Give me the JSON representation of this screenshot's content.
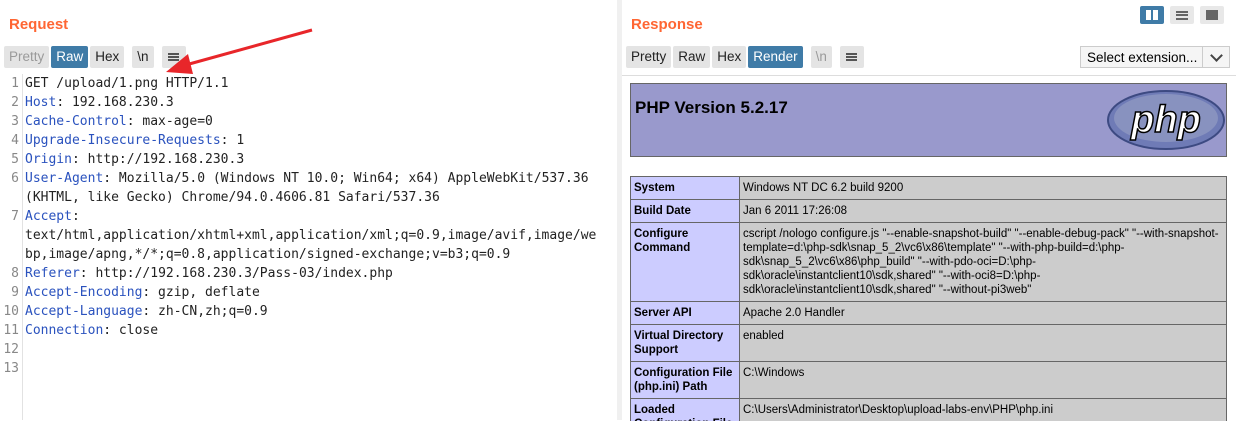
{
  "request": {
    "title": "Request",
    "toolbar": {
      "pretty": "Pretty",
      "raw": "Raw",
      "hex": "Hex",
      "newline": "\\n"
    },
    "lines": [
      {
        "num": "1",
        "key": "",
        "text": "GET /upload/1.png HTTP/1.1"
      },
      {
        "num": "2",
        "key": "Host",
        "text": ": 192.168.230.3"
      },
      {
        "num": "3",
        "key": "Cache-Control",
        "text": ": max-age=0"
      },
      {
        "num": "4",
        "key": "Upgrade-Insecure-Requests",
        "text": ": 1"
      },
      {
        "num": "5",
        "key": "Origin",
        "text": ": http://192.168.230.3"
      },
      {
        "num": "6",
        "key": "User-Agent",
        "text": ": Mozilla/5.0 (Windows NT 10.0; Win64; x64) AppleWebKit/537.36"
      },
      {
        "num": "",
        "key": "",
        "text": "(KHTML, like Gecko) Chrome/94.0.4606.81 Safari/537.36"
      },
      {
        "num": "7",
        "key": "Accept",
        "text": ":"
      },
      {
        "num": "",
        "key": "",
        "text": "text/html,application/xhtml+xml,application/xml;q=0.9,image/avif,image/we"
      },
      {
        "num": "",
        "key": "",
        "text": "bp,image/apng,*/*;q=0.8,application/signed-exchange;v=b3;q=0.9"
      },
      {
        "num": "8",
        "key": "Referer",
        "text": ": http://192.168.230.3/Pass-03/index.php"
      },
      {
        "num": "9",
        "key": "Accept-Encoding",
        "text": ": gzip, deflate"
      },
      {
        "num": "10",
        "key": "Accept-Language",
        "text": ": zh-CN,zh;q=0.9"
      },
      {
        "num": "11",
        "key": "Connection",
        "text": ": close"
      },
      {
        "num": "12",
        "key": "",
        "text": ""
      },
      {
        "num": "13",
        "key": "",
        "text": ""
      }
    ]
  },
  "response": {
    "title": "Response",
    "toolbar": {
      "pretty": "Pretty",
      "raw": "Raw",
      "hex": "Hex",
      "render": "Render",
      "newline": "\\n"
    },
    "select_extension": "Select extension...",
    "render": {
      "php_version": "PHP Version 5.2.17",
      "logo_text": "php",
      "rows": [
        {
          "label": "System",
          "value": "Windows NT DC 6.2 build 9200"
        },
        {
          "label": "Build Date",
          "value": "Jan 6 2011 17:26:08"
        },
        {
          "label": "Configure Command",
          "value": "cscript /nologo configure.js \"--enable-snapshot-build\" \"--enable-debug-pack\" \"--with-snapshot-template=d:\\php-sdk\\snap_5_2\\vc6\\x86\\template\" \"--with-php-build=d:\\php-sdk\\snap_5_2\\vc6\\x86\\php_build\" \"--with-pdo-oci=D:\\php-sdk\\oracle\\instantclient10\\sdk,shared\" \"--with-oci8=D:\\php-sdk\\oracle\\instantclient10\\sdk,shared\" \"--without-pi3web\""
        },
        {
          "label": "Server API",
          "value": "Apache 2.0 Handler"
        },
        {
          "label": "Virtual Directory Support",
          "value": "enabled"
        },
        {
          "label": "Configuration File (php.ini) Path",
          "value": "C:\\Windows"
        },
        {
          "label": "Loaded Configuration File",
          "value": "C:\\Users\\Administrator\\Desktop\\upload-labs-env\\PHP\\php.ini"
        }
      ]
    }
  },
  "colors": {
    "accent": "#ff6633",
    "active_tab": "#3f7ba7",
    "header_key": "#2a52be",
    "php_header": "#9999cc",
    "php_label": "#ccccff",
    "php_value": "#cccccc",
    "arrow": "#e8262a"
  },
  "icons": {
    "menu": "hamburger-icon",
    "layout_split": "columns-icon",
    "layout_rows": "rows-icon",
    "layout_single": "single-pane-icon"
  }
}
